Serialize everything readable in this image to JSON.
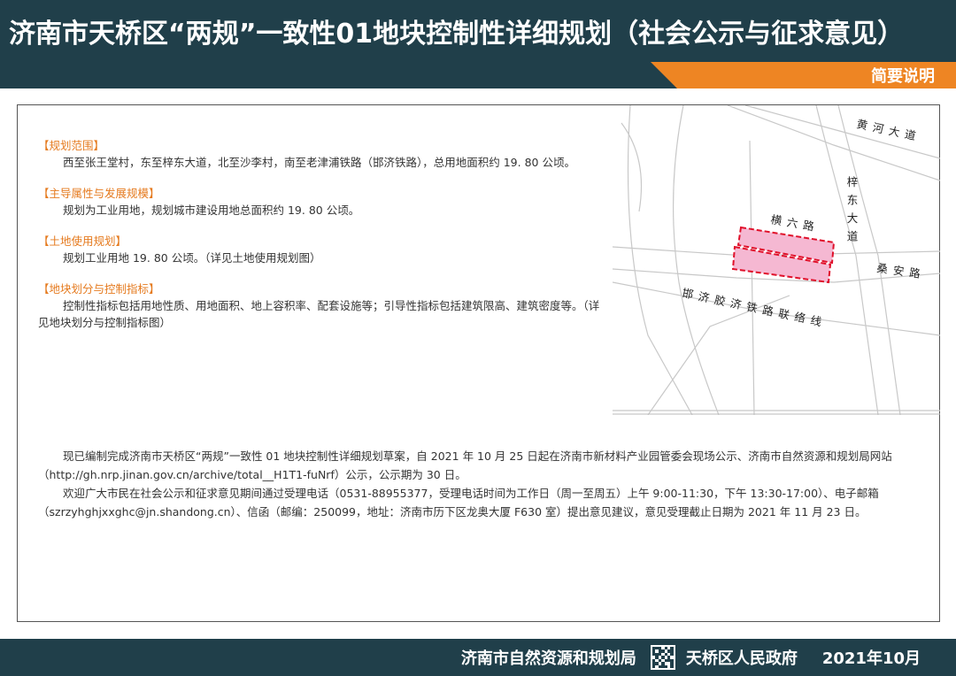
{
  "header": {
    "title": "济南市天桥区“两规”一致性01地块控制性详细规划（社会公示与征求意见）",
    "section_tab": "简要说明"
  },
  "sections": [
    {
      "heading": "【规划范围】",
      "body": "西至张王堂村，东至梓东大道，北至沙李村，南至老津浦铁路（邯济铁路），总用地面积约 19. 80 公顷。"
    },
    {
      "heading": "【主导属性与发展规模】",
      "body": "规划为工业用地，规划城市建设用地总面积约 19. 80 公顷。"
    },
    {
      "heading": "【土地使用规划】",
      "body": "规划工业用地 19. 80 公顷。（详见土地使用规划图）"
    },
    {
      "heading": "【地块划分与控制指标】",
      "body": "控制性指标包括用地性质、用地面积、地上容积率、配套设施等；引导性指标包括建筑限高、建筑密度等。（详见地块划分与控制指标图）"
    }
  ],
  "map": {
    "labels": {
      "huanghe": "黄河大道",
      "zidong": "梓东大道",
      "hengliu": "横六路",
      "sangan": "桑安路",
      "railway": "邯济胶济铁路联络线"
    },
    "colors": {
      "parcel_fill": "#f5b8d2",
      "parcel_border": "#e0102a",
      "road": "#c8c8c8"
    }
  },
  "notice": {
    "p1": "现已编制完成济南市天桥区“两规”一致性 01 地块控制性详细规划草案，自 2021 年 10 月 25 日起在济南市新材料产业园管委会现场公示、济南市自然资源和规划局网站（http://gh.nrp.jinan.gov.cn/archive/total__H1T1-fuNrf）公示，公示期为 30 日。",
    "p2": "欢迎广大市民在社会公示和征求意见期间通过受理电话（0531-88955377，受理电话时间为工作日（周一至周五）上午 9:00-11:30，下午 13:30-17:00）、电子邮箱（szrzyhghjxxghc@jn.shandong.cn）、信函（邮编：250099，地址：济南市历下区龙奥大厦 F630 室）提出意见建议，意见受理截止日期为 2021 年 11 月 23 日。"
  },
  "footer": {
    "org1": "济南市自然资源和规划局",
    "org2": "天桥区人民政府",
    "date": "2021年10月",
    "qr_icon": "qr-code-icon"
  }
}
